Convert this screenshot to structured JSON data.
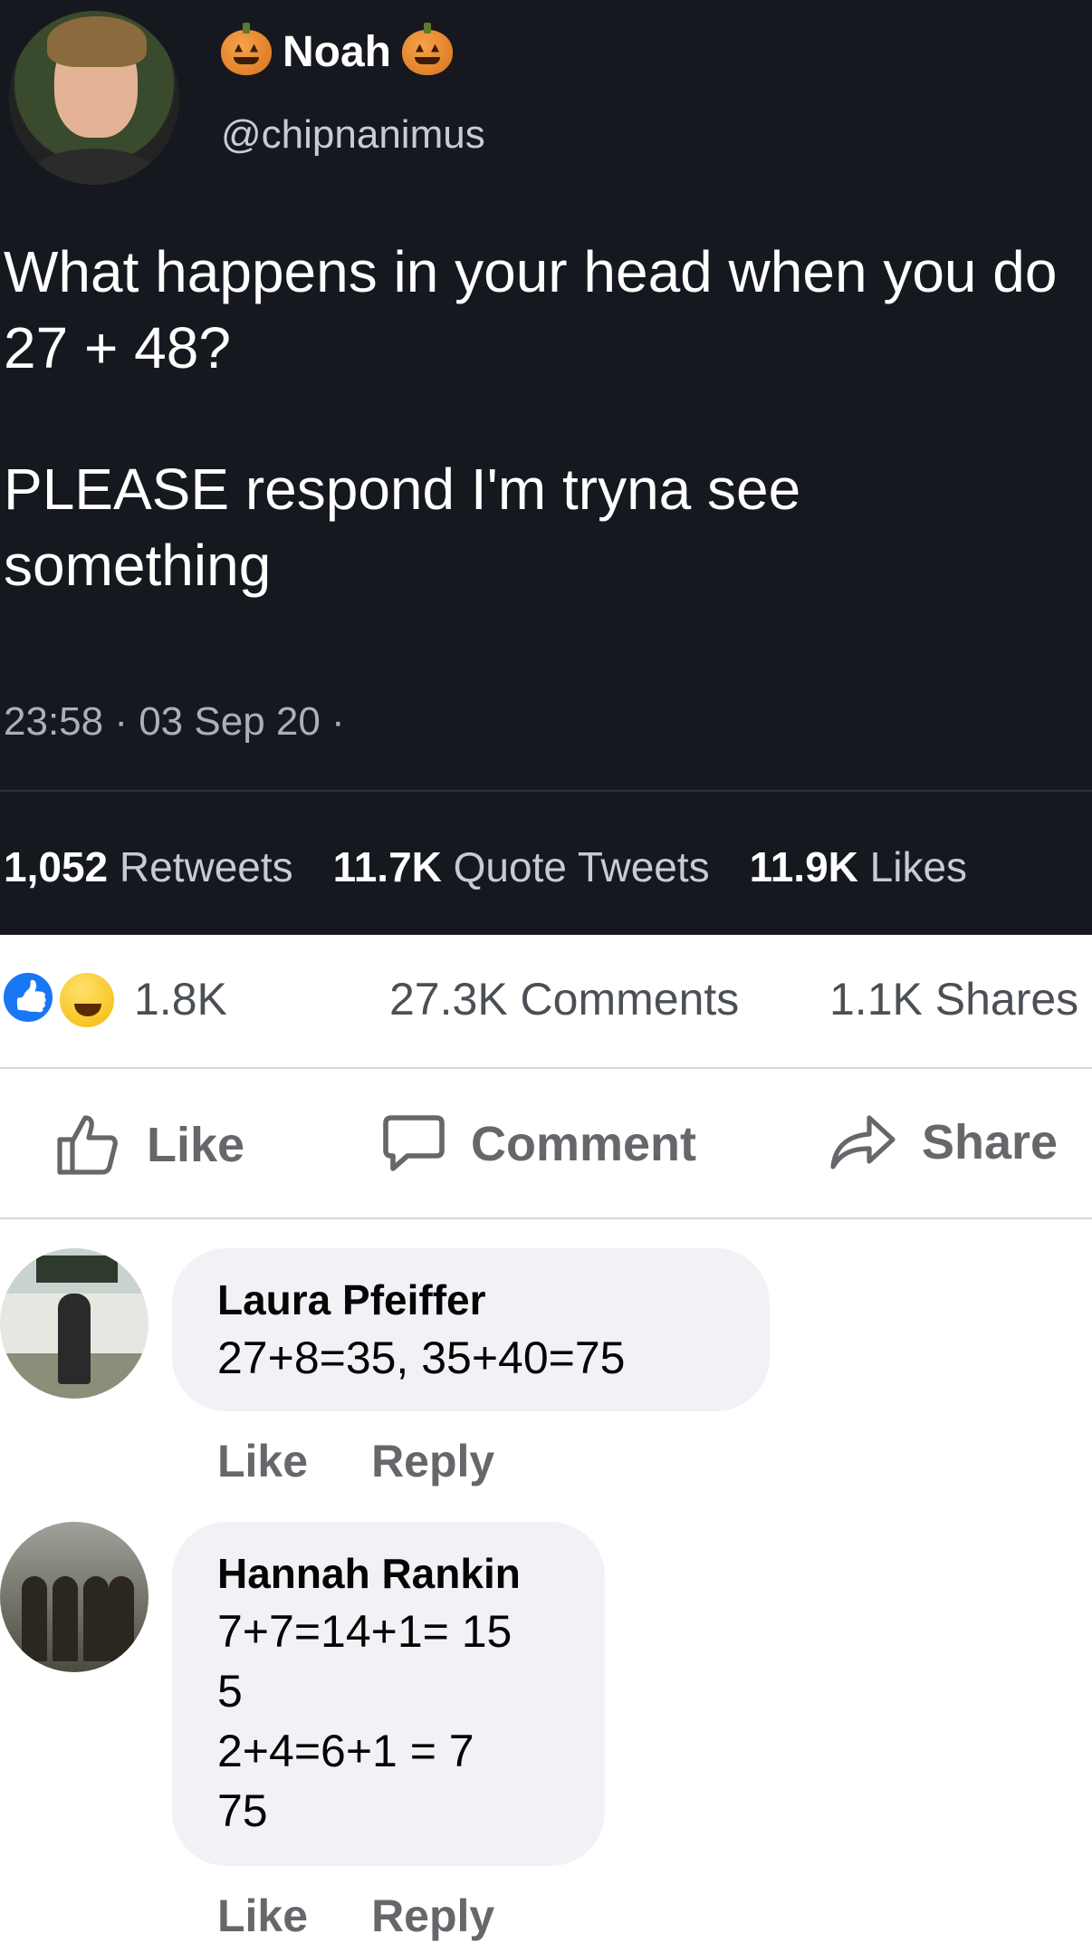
{
  "tweet": {
    "display_name": "Noah",
    "handle": "@chipnanimus",
    "text_line1": "What happens in your head when you do 27 + 48?",
    "text_line2": "PLEASE respond I'm tryna see something",
    "timestamp": "23:58 · 03 Sep 20 ·",
    "stats": [
      {
        "value": "1,052",
        "label": "Retweets"
      },
      {
        "value": "11.7K",
        "label": "Quote Tweets"
      },
      {
        "value": "11.9K",
        "label": "Likes"
      }
    ],
    "icons": [
      "pumpkin-emoji",
      "pumpkin-emoji"
    ]
  },
  "facebook": {
    "reaction_count": "1.8K",
    "comment_count": "27.3K Comments",
    "share_count": "1.1K Shares",
    "reaction_icons": [
      "like-reaction-icon",
      "haha-reaction-icon"
    ],
    "actions": {
      "like": "Like",
      "comment": "Comment",
      "share": "Share"
    },
    "comments": [
      {
        "author": "Laura Pfeiffer",
        "text": "27+8=35, 35+40=75",
        "like": "Like",
        "reply": "Reply"
      },
      {
        "author": "Hannah Rankin",
        "text": "7+7=14+1= 15\n5\n2+4=6+1 = 7\n75",
        "like": "Like",
        "reply": "Reply"
      }
    ]
  }
}
